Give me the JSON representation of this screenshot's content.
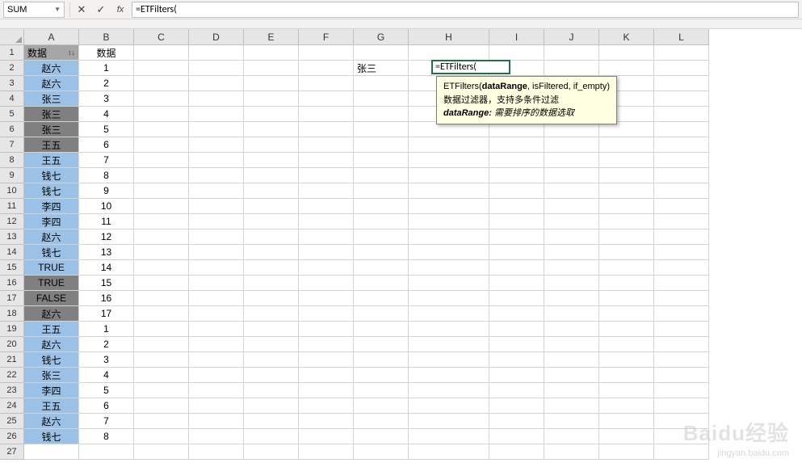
{
  "name_box": "SUM",
  "formula_bar": "=ETFilters(",
  "columns": [
    "A",
    "B",
    "C",
    "D",
    "E",
    "F",
    "G",
    "H",
    "I",
    "J",
    "K",
    "L"
  ],
  "row_numbers": [
    1,
    2,
    3,
    4,
    5,
    6,
    7,
    8,
    9,
    10,
    11,
    12,
    13,
    14,
    15,
    16,
    17,
    18,
    19,
    20,
    21,
    22,
    23,
    24,
    25,
    26,
    27
  ],
  "grid": {
    "header": {
      "A": "数据",
      "B": "数据"
    },
    "rows": [
      {
        "A": "赵六",
        "B": "1"
      },
      {
        "A": "赵六",
        "B": "2"
      },
      {
        "A": "张三",
        "B": "3"
      },
      {
        "A": "张三",
        "B": "4"
      },
      {
        "A": "张三",
        "B": "5"
      },
      {
        "A": "王五",
        "B": "6"
      },
      {
        "A": "王五",
        "B": "7"
      },
      {
        "A": "钱七",
        "B": "8"
      },
      {
        "A": "钱七",
        "B": "9"
      },
      {
        "A": "李四",
        "B": "10"
      },
      {
        "A": "李四",
        "B": "11"
      },
      {
        "A": "赵六",
        "B": "12"
      },
      {
        "A": "钱七",
        "B": "13"
      },
      {
        "A": "TRUE",
        "B": "14"
      },
      {
        "A": "TRUE",
        "B": "15"
      },
      {
        "A": "FALSE",
        "B": "16"
      },
      {
        "A": "赵六",
        "B": "17"
      },
      {
        "A": "王五",
        "B": "1"
      },
      {
        "A": "赵六",
        "B": "2"
      },
      {
        "A": "钱七",
        "B": "3"
      },
      {
        "A": "张三",
        "B": "4"
      },
      {
        "A": "李四",
        "B": "5"
      },
      {
        "A": "王五",
        "B": "6"
      },
      {
        "A": "赵六",
        "B": "7"
      },
      {
        "A": "钱七",
        "B": "8"
      }
    ],
    "G2": "张三",
    "H2": "=ETFilters("
  },
  "active_cell": {
    "ref": "H2",
    "value": "=ETFilters("
  },
  "tooltip": {
    "line1_prefix": "ETFilters(",
    "line1_bold": "dataRange",
    "line1_suffix": ", isFiltered, if_empty)",
    "line2": "数据过滤器，支持多条件过滤",
    "line3_bold": "dataRange:",
    "line3_italic": " 需要排序的数据选取"
  },
  "watermark": {
    "main": "Baidu经验",
    "sub": "jingyan.baidu.com"
  }
}
